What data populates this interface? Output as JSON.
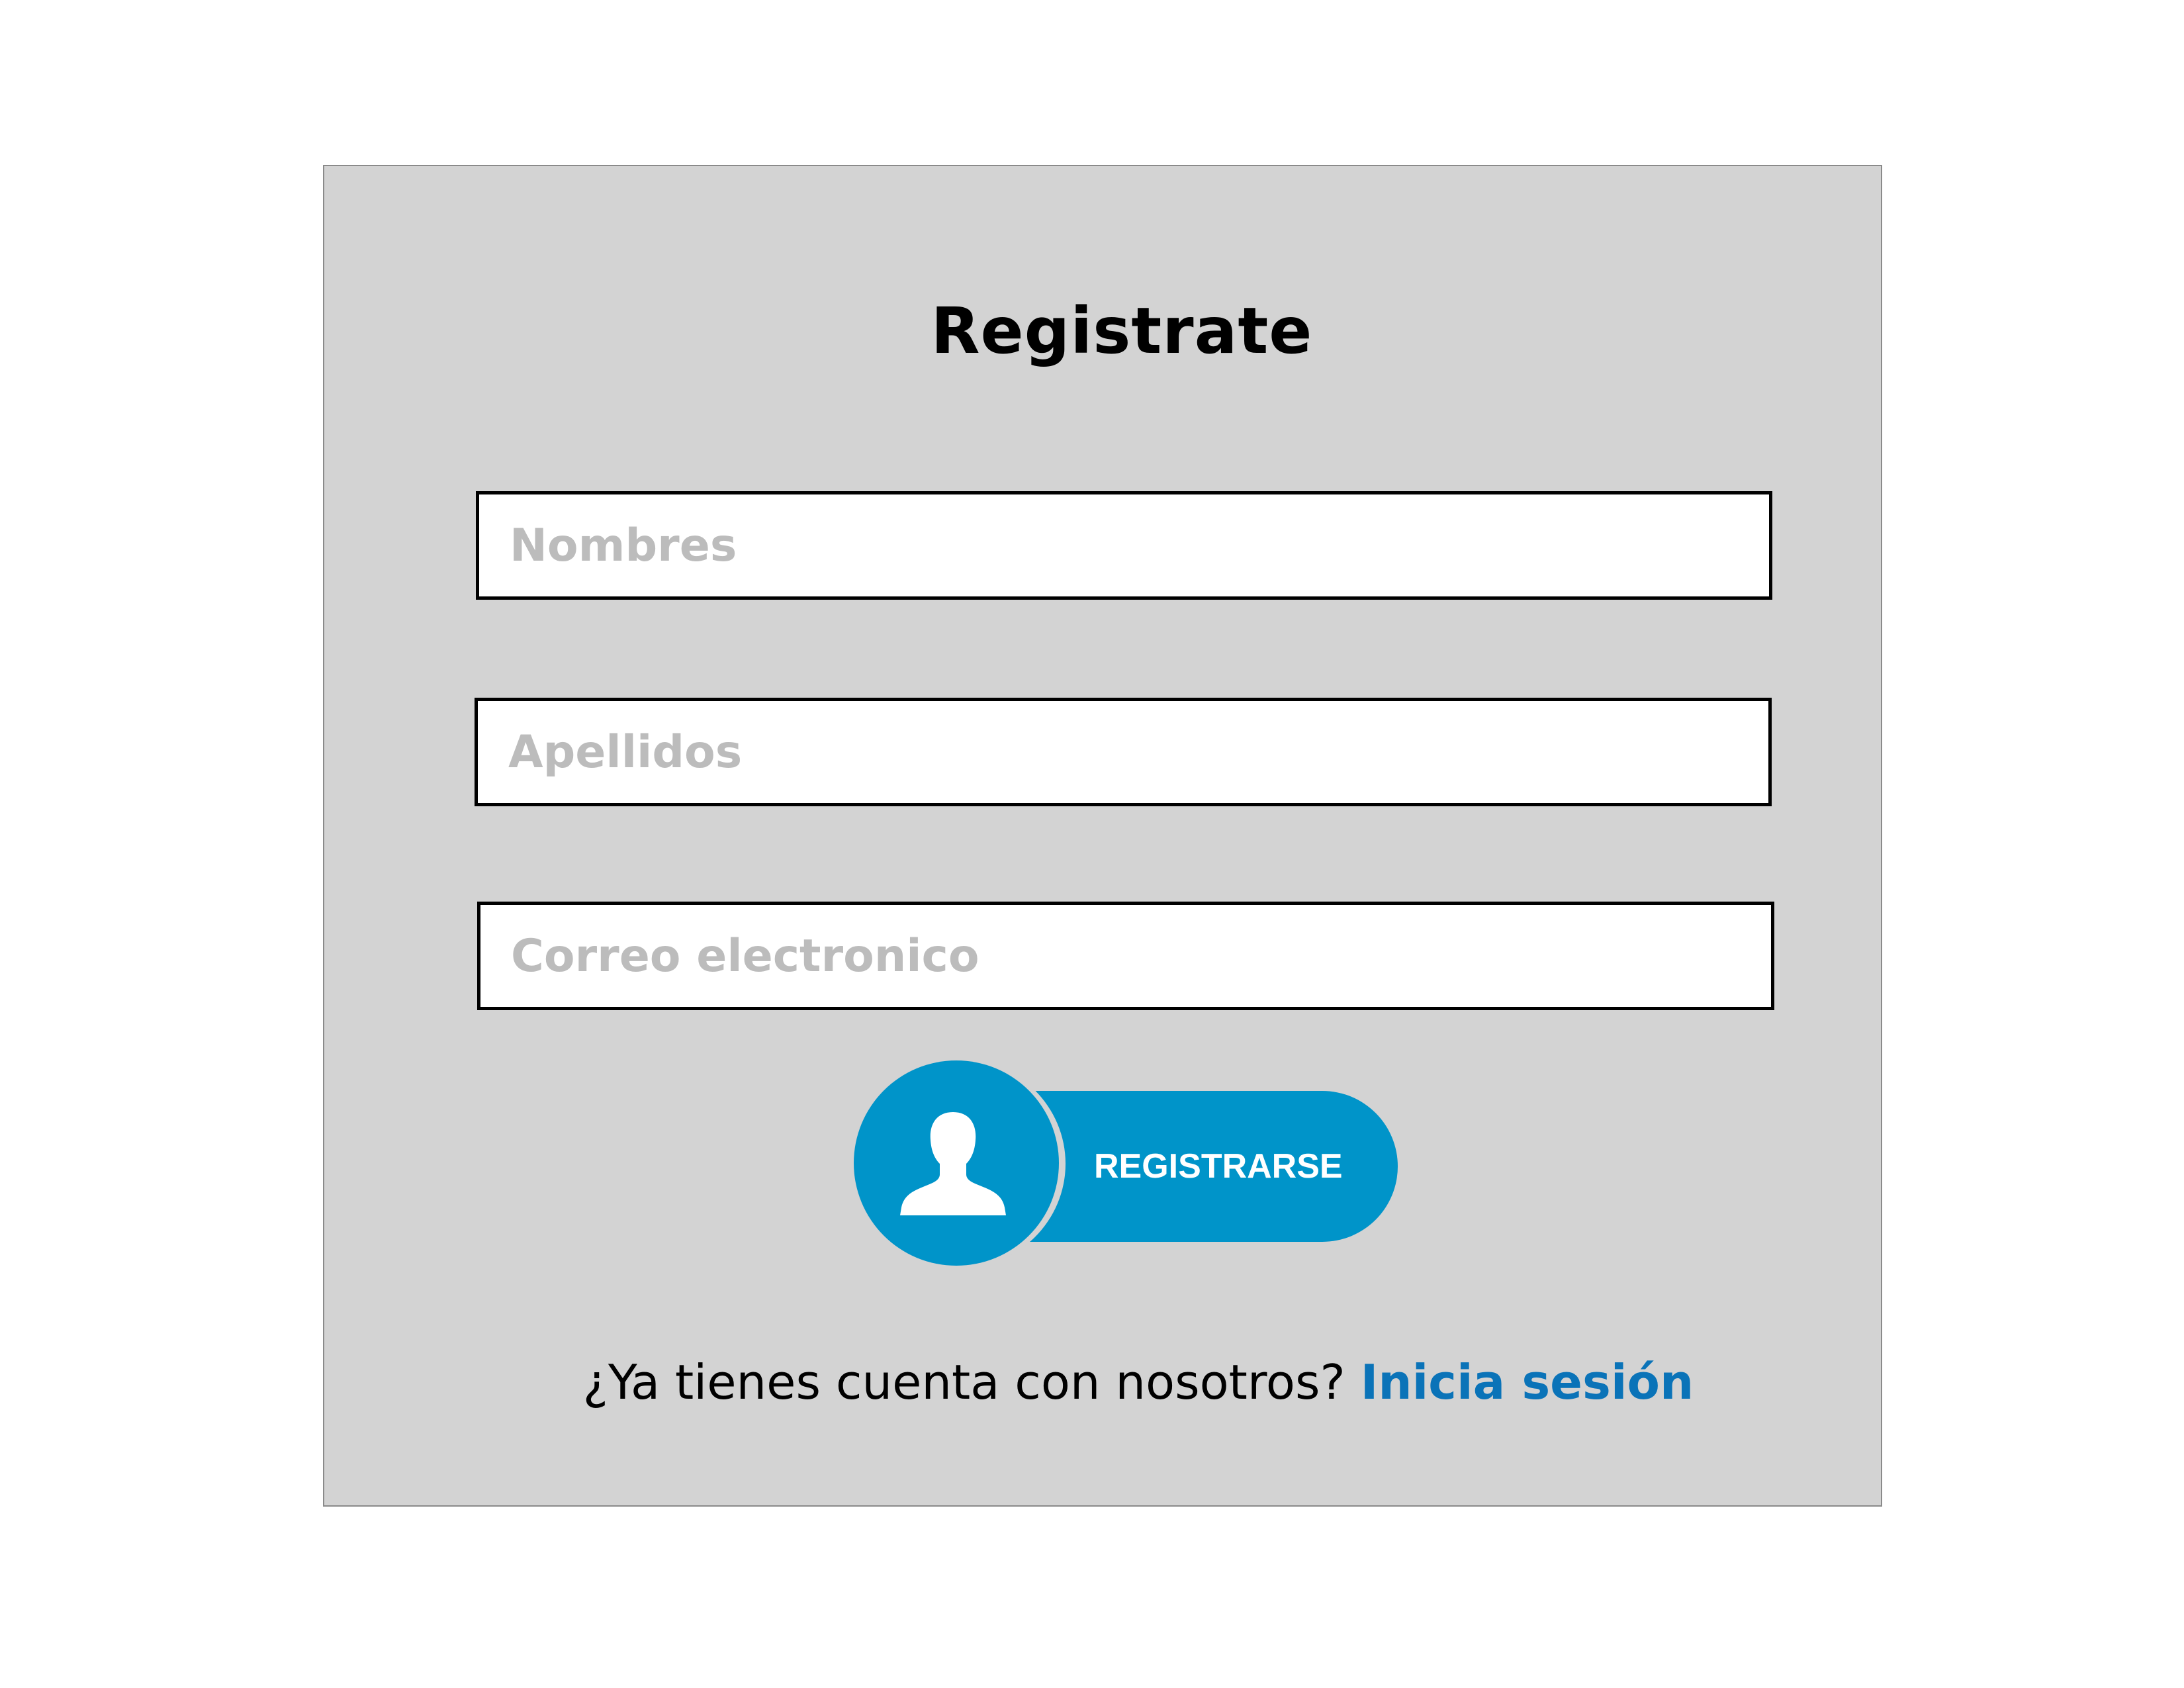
{
  "form": {
    "title": "Registrate",
    "fields": {
      "nombres_placeholder": "Nombres",
      "apellidos_placeholder": "Apellidos",
      "correo_placeholder": "Correo electronico"
    },
    "submit_label": "REGISTRARSE",
    "submit_icon": "user-icon",
    "footer_text": "¿Ya tienes cuenta con nosotros?",
    "footer_link": "Inicia sesión"
  },
  "colors": {
    "panel_bg": "#d3d3d3",
    "accent": "#0094c9",
    "link": "#0a73b8",
    "placeholder": "#bcbcbc"
  }
}
